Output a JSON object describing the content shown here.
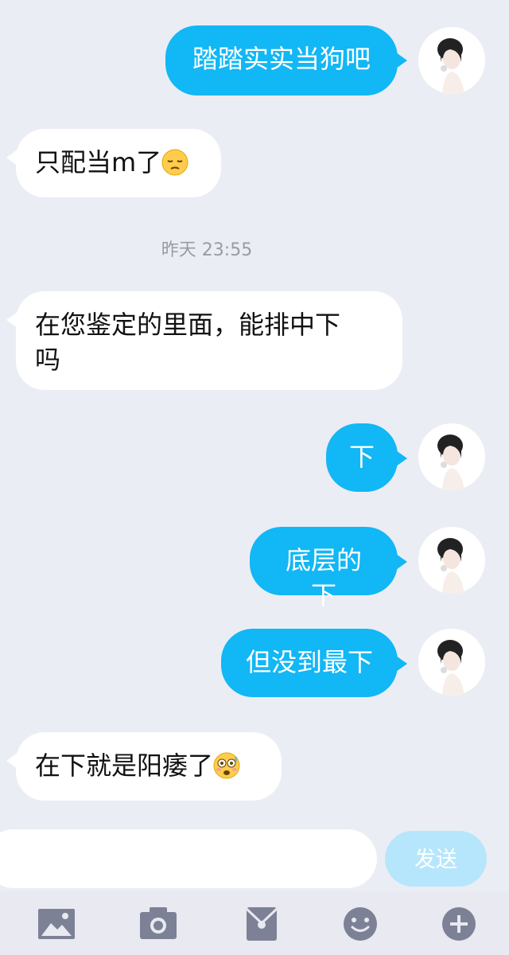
{
  "messages": [
    {
      "side": "out",
      "text": "踏踏实实当狗吧"
    },
    {
      "side": "in",
      "text": "只配当m了",
      "emoji": "pensive-face-emoji"
    },
    {
      "type": "timestamp",
      "text": "昨天 23:55"
    },
    {
      "side": "in",
      "text": "在您鉴定的里面，能排中下\n吗"
    },
    {
      "side": "out",
      "text": "下"
    },
    {
      "side": "out",
      "text": "底层的下"
    },
    {
      "side": "out",
      "text": "但没到最下"
    },
    {
      "side": "in",
      "text": "在下就是阳痿了",
      "emoji": "flushed-sweat-emoji"
    }
  ],
  "composer": {
    "input_value": "",
    "send_label": "发送"
  },
  "toolbar": {
    "icons": [
      "image-icon",
      "camera-icon",
      "red-packet-icon",
      "emoji-icon",
      "plus-icon"
    ]
  },
  "colors": {
    "outgoing_bubble": "#12b7f5",
    "incoming_bubble": "#ffffff",
    "background": "#ebedf5",
    "send_button": "#b6e6fb"
  }
}
